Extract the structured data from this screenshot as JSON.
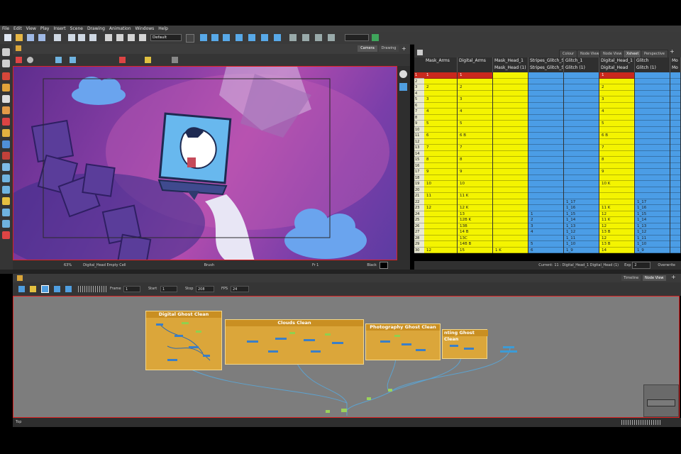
{
  "menu": [
    "File",
    "Edit",
    "View",
    "Play",
    "Insert",
    "Scene",
    "Drawing",
    "Animation",
    "Windows",
    "Help"
  ],
  "toolbar": {
    "preset_label": "Default"
  },
  "camera_tabs": [
    "Camera",
    "Drawing"
  ],
  "camera_status": {
    "zoom": "63%",
    "layer": "Digital_Head Empty Cell",
    "tool": "Brush",
    "frame": "Fr 1",
    "color": "Black"
  },
  "xsheet_tabs": [
    "Colour",
    "Node View",
    "Node View",
    "Xsheet",
    "Perspective"
  ],
  "xsheet_columns": [
    {
      "l1": "Mask_Arms",
      "l2": "",
      "color": "#f4f400"
    },
    {
      "l1": "Digital_Arms",
      "l2": "",
      "color": "#f4f400"
    },
    {
      "l1": "Mask_Head_1",
      "l2": "Mask_Head (1)",
      "color": "#f4f400"
    },
    {
      "l1": "Stripes_Glitch_S",
      "l2": "Stripes_Glitch_S",
      "color": "#4b9de6"
    },
    {
      "l1": "Glitch_1",
      "l2": "Glitch (1)",
      "color": "#4b9de6"
    },
    {
      "l1": "Digital_Head_1",
      "l2": "Digital_Head (1)",
      "color": "#f4f400"
    },
    {
      "l1": "Glitch",
      "l2": "Glitch (1)",
      "color": "#4b9de6"
    },
    {
      "l1": "Mo",
      "l2": "Mo",
      "color": "#4b9de6"
    }
  ],
  "xsheet_rows": [
    [
      "1",
      "1",
      "",
      "",
      "",
      "1",
      "",
      ""
    ],
    [
      "",
      "",
      "",
      "",
      "",
      "",
      "",
      ""
    ],
    [
      "2",
      "2",
      "",
      "",
      "",
      "2",
      "",
      ""
    ],
    [
      "",
      "",
      "",
      "",
      "",
      "",
      "",
      ""
    ],
    [
      "3",
      "3",
      "",
      "",
      "",
      "3",
      "",
      ""
    ],
    [
      "",
      "",
      "",
      "",
      "",
      "",
      "",
      ""
    ],
    [
      "4",
      "4",
      "",
      "",
      "",
      "4",
      "",
      ""
    ],
    [
      "",
      "",
      "",
      "",
      "",
      "",
      "",
      ""
    ],
    [
      "5",
      "5",
      "",
      "",
      "",
      "5",
      "",
      ""
    ],
    [
      "",
      "",
      "",
      "",
      "",
      "",
      "",
      ""
    ],
    [
      "6",
      "6 B",
      "",
      "",
      "",
      "6 B",
      "",
      ""
    ],
    [
      "",
      "",
      "",
      "",
      "",
      "",
      "",
      ""
    ],
    [
      "7",
      "7",
      "",
      "",
      "",
      "7",
      "",
      ""
    ],
    [
      "",
      "",
      "",
      "",
      "",
      "",
      "",
      ""
    ],
    [
      "8",
      "8",
      "",
      "",
      "",
      "8",
      "",
      ""
    ],
    [
      "",
      "",
      "",
      "",
      "",
      "",
      "",
      ""
    ],
    [
      "9",
      "9",
      "",
      "",
      "",
      "9",
      "",
      ""
    ],
    [
      "",
      "",
      "",
      "",
      "",
      "",
      "",
      ""
    ],
    [
      "10",
      "10",
      "",
      "",
      "",
      "10 K",
      "",
      ""
    ],
    [
      "",
      "",
      "",
      "",
      "",
      "",
      "",
      ""
    ],
    [
      "11",
      "11 K",
      "",
      "",
      "",
      "",
      "",
      ""
    ],
    [
      "",
      "",
      "",
      "",
      "1_17",
      "",
      "1_17",
      ""
    ],
    [
      "12",
      "12 K",
      "",
      "",
      "1_16",
      "11 K",
      "1_16",
      ""
    ],
    [
      "",
      "13",
      "",
      "1",
      "1_15",
      "12",
      "1_15",
      ""
    ],
    [
      "",
      "12B K",
      "",
      "2",
      "1_14",
      "11 K",
      "1_14",
      ""
    ],
    [
      "",
      "13B",
      "",
      "3",
      "1_13",
      "12",
      "1_13",
      ""
    ],
    [
      "",
      "14 B",
      "",
      "4",
      "1_12",
      "13 B",
      "1_12",
      ""
    ],
    [
      "",
      "13C",
      "",
      "",
      "1_11",
      "12",
      "1_11",
      ""
    ],
    [
      "",
      "14B B",
      "",
      "5",
      "1_10",
      "13 B",
      "1_10",
      ""
    ],
    [
      "12",
      "15",
      "1 K",
      "6",
      "1_9",
      "14",
      "1_9",
      ""
    ]
  ],
  "xsheet_status": {
    "current": "Current: 11 : Digital_Head_1 Digital_Head (1)",
    "exp_label": "Exp",
    "exp_value": "2",
    "mode": "Overwrite"
  },
  "nv_tabs": [
    "Timeline",
    "Node View"
  ],
  "playback": {
    "frame_label": "Frame",
    "frame": "1",
    "start_label": "Start",
    "start": "1",
    "stop_label": "Stop",
    "stop": "208",
    "fps_label": "FPS",
    "fps": "24"
  },
  "backdrops": [
    {
      "title": "Digital Ghost Clean"
    },
    {
      "title": "Clouds Clean"
    },
    {
      "title": "Photography Ghost Clean"
    },
    {
      "title": "nting Ghost Clean"
    }
  ],
  "nv_status": {
    "path": "Top"
  },
  "colors": {
    "yellow_col": "#f4f400",
    "blue_col": "#4b9de6",
    "selected_row": "#c9281d",
    "backdrop": "#dba63a"
  }
}
